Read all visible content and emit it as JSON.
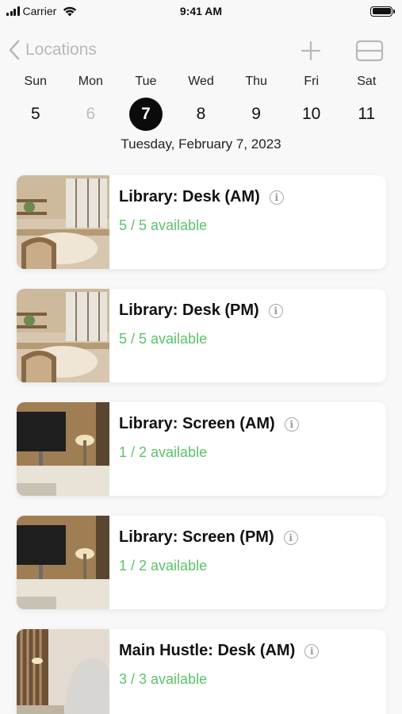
{
  "status_bar": {
    "carrier": "Carrier",
    "time": "9:41 AM"
  },
  "nav": {
    "back_label": "Locations",
    "icons": [
      "chevron-left-icon",
      "plus-icon",
      "layout-toggle-icon"
    ]
  },
  "week": {
    "days": [
      {
        "name": "Sun",
        "num": "5"
      },
      {
        "name": "Mon",
        "num": "6"
      },
      {
        "name": "Tue",
        "num": "7"
      },
      {
        "name": "Wed",
        "num": "8"
      },
      {
        "name": "Thu",
        "num": "9"
      },
      {
        "name": "Fri",
        "num": "10"
      },
      {
        "name": "Sat",
        "num": "11"
      }
    ],
    "selected_index": 2,
    "dimmed_index": 1,
    "selected_date": "Tuesday, February 7, 2023"
  },
  "locations": [
    {
      "title": "Library: Desk (AM)",
      "availability": "5 / 5 available",
      "photo": "library-desk"
    },
    {
      "title": "Library: Desk (PM)",
      "availability": "5 / 5 available",
      "photo": "library-desk"
    },
    {
      "title": "Library: Screen (AM)",
      "availability": "1 / 2 available",
      "photo": "library-screen"
    },
    {
      "title": "Library: Screen (PM)",
      "availability": "1 / 2 available",
      "photo": "library-screen"
    },
    {
      "title": "Main Hustle: Desk (AM)",
      "availability": "3 / 3 available",
      "photo": "main-hustle-desk"
    }
  ],
  "colors": {
    "available": "#5cc36a",
    "selected_day": "#0b0b0b",
    "nav_tint": "#b8b8b8"
  }
}
